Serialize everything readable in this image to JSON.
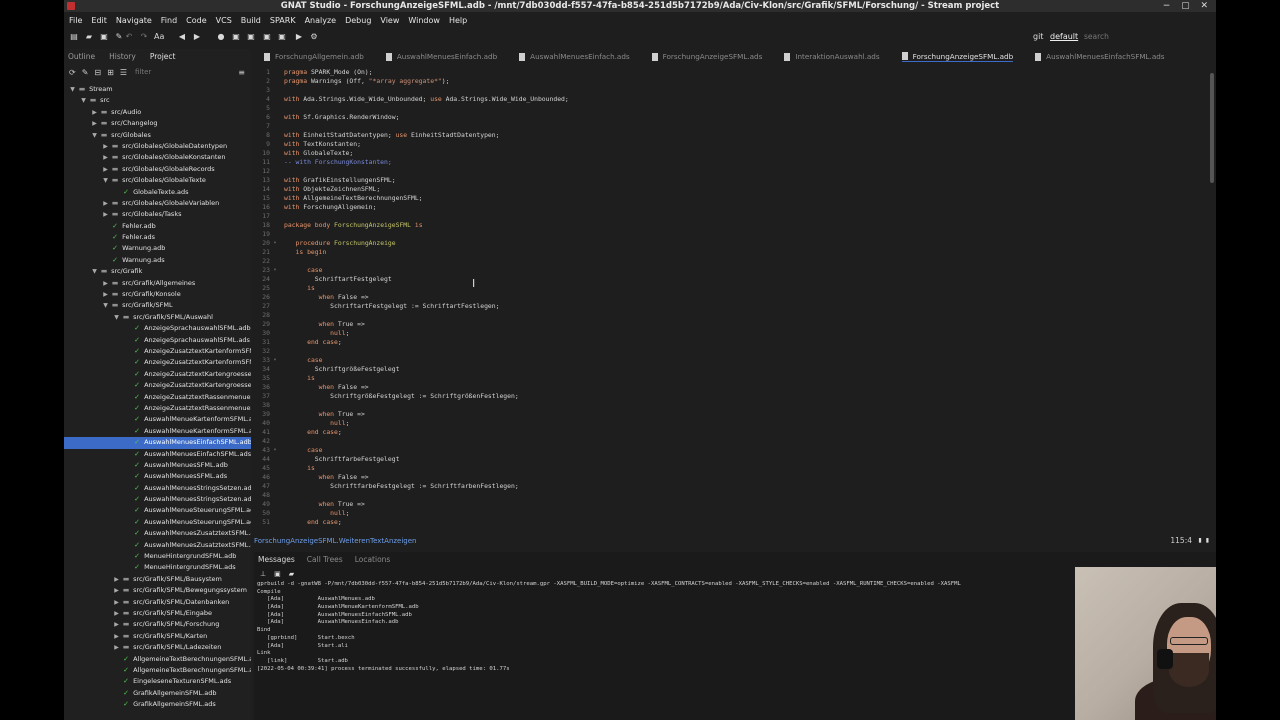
{
  "window": {
    "title": "GNAT Studio - ForschungAnzeigeSFML.adb - /mnt/7db030dd-f557-47fa-b854-251d5b7172b9/Ada/Civ-Klon/src/Grafik/SFML/Forschung/ - Stream project",
    "controls": "− ▢ ✕"
  },
  "menubar": [
    "File",
    "Edit",
    "Navigate",
    "Find",
    "Code",
    "VCS",
    "Build",
    "SPARK",
    "Analyze",
    "Debug",
    "View",
    "Window",
    "Help"
  ],
  "toolbar": {
    "git_label": "git",
    "scenario_value": "default",
    "search_placeholder": "search"
  },
  "left_panel": {
    "tabs": [
      "Outline",
      "History",
      "Project"
    ],
    "filter_placeholder": "filter",
    "tree": [
      {
        "label": "Stream",
        "depth": 0,
        "arrow": "▼",
        "icon": "folder"
      },
      {
        "label": "src",
        "depth": 1,
        "arrow": "▼",
        "icon": "folder"
      },
      {
        "label": "src/Audio",
        "depth": 2,
        "arrow": "▶",
        "icon": "folder"
      },
      {
        "label": "src/Changelog",
        "depth": 2,
        "arrow": "▶",
        "icon": "folder"
      },
      {
        "label": "src/Globales",
        "depth": 2,
        "arrow": "▼",
        "icon": "folder"
      },
      {
        "label": "src/Globales/GlobaleDatentypen",
        "depth": 3,
        "arrow": "▶",
        "icon": "folder"
      },
      {
        "label": "src/Globales/GlobaleKonstanten",
        "depth": 3,
        "arrow": "▶",
        "icon": "folder"
      },
      {
        "label": "src/Globales/GlobaleRecords",
        "depth": 3,
        "arrow": "▶",
        "icon": "folder"
      },
      {
        "label": "src/Globales/GlobaleTexte",
        "depth": 3,
        "arrow": "▼",
        "icon": "folder"
      },
      {
        "label": "GlobaleTexte.ads",
        "depth": 4,
        "arrow": "",
        "icon": "check"
      },
      {
        "label": "src/Globales/GlobaleVariablen",
        "depth": 3,
        "arrow": "▶",
        "icon": "folder"
      },
      {
        "label": "src/Globales/Tasks",
        "depth": 3,
        "arrow": "▶",
        "icon": "folder"
      },
      {
        "label": "Fehler.adb",
        "depth": 3,
        "arrow": "",
        "icon": "check"
      },
      {
        "label": "Fehler.ads",
        "depth": 3,
        "arrow": "",
        "icon": "check"
      },
      {
        "label": "Warnung.adb",
        "depth": 3,
        "arrow": "",
        "icon": "check"
      },
      {
        "label": "Warnung.ads",
        "depth": 3,
        "arrow": "",
        "icon": "check"
      },
      {
        "label": "src/Grafik",
        "depth": 2,
        "arrow": "▼",
        "icon": "folder"
      },
      {
        "label": "src/Grafik/Allgemeines",
        "depth": 3,
        "arrow": "▶",
        "icon": "folder"
      },
      {
        "label": "src/Grafik/Konsole",
        "depth": 3,
        "arrow": "▶",
        "icon": "folder"
      },
      {
        "label": "src/Grafik/SFML",
        "depth": 3,
        "arrow": "▼",
        "icon": "folder"
      },
      {
        "label": "src/Grafik/SFML/Auswahl",
        "depth": 4,
        "arrow": "▼",
        "icon": "folder"
      },
      {
        "label": "AnzeigeSprachauswahlSFML.adb",
        "depth": 5,
        "arrow": "",
        "icon": "check"
      },
      {
        "label": "AnzeigeSprachauswahlSFML.ads",
        "depth": 5,
        "arrow": "",
        "icon": "check"
      },
      {
        "label": "AnzeigeZusatztextKartenformSFM",
        "depth": 5,
        "arrow": "",
        "icon": "check"
      },
      {
        "label": "AnzeigeZusatztextKartenformSFM",
        "depth": 5,
        "arrow": "",
        "icon": "check"
      },
      {
        "label": "AnzeigeZusatztextKartengroesse",
        "depth": 5,
        "arrow": "",
        "icon": "check"
      },
      {
        "label": "AnzeigeZusatztextKartengroesse",
        "depth": 5,
        "arrow": "",
        "icon": "check"
      },
      {
        "label": "AnzeigeZusatztextRassenmenueSF",
        "depth": 5,
        "arrow": "",
        "icon": "check"
      },
      {
        "label": "AnzeigeZusatztextRassenmenueSF",
        "depth": 5,
        "arrow": "",
        "icon": "check"
      },
      {
        "label": "AuswahlMenueKartenformSFML.adb",
        "depth": 5,
        "arrow": "",
        "icon": "check"
      },
      {
        "label": "AuswahlMenueKartenformSFML.ads",
        "depth": 5,
        "arrow": "",
        "icon": "check"
      },
      {
        "label": "AuswahlMenuesEinfachSFML.adb",
        "depth": 5,
        "arrow": "",
        "icon": "check",
        "selected": true
      },
      {
        "label": "AuswahlMenuesEinfachSFML.ads",
        "depth": 5,
        "arrow": "",
        "icon": "check"
      },
      {
        "label": "AuswahlMenuesSFML.adb",
        "depth": 5,
        "arrow": "",
        "icon": "check"
      },
      {
        "label": "AuswahlMenuesSFML.ads",
        "depth": 5,
        "arrow": "",
        "icon": "check"
      },
      {
        "label": "AuswahlMenuesStringsSetzen.adb",
        "depth": 5,
        "arrow": "",
        "icon": "check"
      },
      {
        "label": "AuswahlMenuesStringsSetzen.ads",
        "depth": 5,
        "arrow": "",
        "icon": "check"
      },
      {
        "label": "AuswahlMenueSteuerungSFML.adb",
        "depth": 5,
        "arrow": "",
        "icon": "check"
      },
      {
        "label": "AuswahlMenueSteuerungSFML.ads",
        "depth": 5,
        "arrow": "",
        "icon": "check"
      },
      {
        "label": "AuswahlMenuesZusatztextSFML.ad",
        "depth": 5,
        "arrow": "",
        "icon": "check"
      },
      {
        "label": "AuswahlMenuesZusatztextSFML.ad",
        "depth": 5,
        "arrow": "",
        "icon": "check"
      },
      {
        "label": "MenueHintergrundSFML.adb",
        "depth": 5,
        "arrow": "",
        "icon": "check"
      },
      {
        "label": "MenueHintergrundSFML.ads",
        "depth": 5,
        "arrow": "",
        "icon": "check"
      },
      {
        "label": "src/Grafik/SFML/Bausystem",
        "depth": 4,
        "arrow": "▶",
        "icon": "folder"
      },
      {
        "label": "src/Grafik/SFML/Bewegungssystem",
        "depth": 4,
        "arrow": "▶",
        "icon": "folder"
      },
      {
        "label": "src/Grafik/SFML/Datenbanken",
        "depth": 4,
        "arrow": "▶",
        "icon": "folder"
      },
      {
        "label": "src/Grafik/SFML/Eingabe",
        "depth": 4,
        "arrow": "▶",
        "icon": "folder"
      },
      {
        "label": "src/Grafik/SFML/Forschung",
        "depth": 4,
        "arrow": "▶",
        "icon": "folder"
      },
      {
        "label": "src/Grafik/SFML/Karten",
        "depth": 4,
        "arrow": "▶",
        "icon": "folder"
      },
      {
        "label": "src/Grafik/SFML/Ladezeiten",
        "depth": 4,
        "arrow": "▶",
        "icon": "folder"
      },
      {
        "label": "AllgemeineTextBerechnungenSFML.ad",
        "depth": 4,
        "arrow": "",
        "icon": "check"
      },
      {
        "label": "AllgemeineTextBerechnungenSFML.ad",
        "depth": 4,
        "arrow": "",
        "icon": "check"
      },
      {
        "label": "EingeleseneTexturenSFML.ads",
        "depth": 4,
        "arrow": "",
        "icon": "check"
      },
      {
        "label": "GrafikAllgemeinSFML.adb",
        "depth": 4,
        "arrow": "",
        "icon": "check"
      },
      {
        "label": "GrafikAllgemeinSFML.ads",
        "depth": 4,
        "arrow": "",
        "icon": "check"
      }
    ]
  },
  "editor": {
    "tabs": [
      {
        "label": "ForschungAllgemein.adb",
        "active": false
      },
      {
        "label": "AuswahlMenuesEinfach.adb",
        "active": false
      },
      {
        "label": "AuswahlMenuesEinfach.ads",
        "active": false
      },
      {
        "label": "ForschungAnzeigeSFML.ads",
        "active": false
      },
      {
        "label": "InteraktionAuswahl.ads",
        "active": false
      },
      {
        "label": "ForschungAnzeigeSFML.adb",
        "active": true
      },
      {
        "label": "AuswahlMenuesEinfachSFML.ads",
        "active": false
      }
    ],
    "lines": [
      {
        "n": "1",
        "fold": "",
        "segs": [
          [
            "kw",
            "pragma"
          ],
          [
            "t",
            " SPARK_Mode (On);"
          ]
        ]
      },
      {
        "n": "2",
        "fold": "",
        "segs": [
          [
            "kw",
            "pragma"
          ],
          [
            "t",
            " Warnings (Off, "
          ],
          [
            "str",
            "\"*array aggregate*\""
          ],
          [
            "t",
            ");"
          ]
        ]
      },
      {
        "n": "3",
        "fold": "",
        "segs": []
      },
      {
        "n": "4",
        "fold": "",
        "segs": [
          [
            "kw",
            "with"
          ],
          [
            "t",
            " Ada.Strings.Wide_Wide_Unbounded; "
          ],
          [
            "kw",
            "use"
          ],
          [
            "t",
            " Ada.Strings.Wide_Wide_Unbounded;"
          ]
        ]
      },
      {
        "n": "5",
        "fold": "",
        "segs": []
      },
      {
        "n": "6",
        "fold": "",
        "segs": [
          [
            "kw",
            "with"
          ],
          [
            "t",
            " Sf.Graphics.RenderWindow;"
          ]
        ]
      },
      {
        "n": "7",
        "fold": "",
        "segs": []
      },
      {
        "n": "8",
        "fold": "",
        "segs": [
          [
            "kw",
            "with"
          ],
          [
            "t",
            " EinheitStadtDatentypen; "
          ],
          [
            "kw",
            "use"
          ],
          [
            "t",
            " EinheitStadtDatentypen;"
          ]
        ]
      },
      {
        "n": "9",
        "fold": "",
        "segs": [
          [
            "kw",
            "with"
          ],
          [
            "t",
            " TextKonstanten;"
          ]
        ]
      },
      {
        "n": "10",
        "fold": "",
        "segs": [
          [
            "kw",
            "with"
          ],
          [
            "t",
            " GlobaleTexte;"
          ]
        ]
      },
      {
        "n": "11",
        "fold": "",
        "segs": [
          [
            "cm",
            "-- with ForschungKonstanten;"
          ]
        ]
      },
      {
        "n": "12",
        "fold": "",
        "segs": []
      },
      {
        "n": "13",
        "fold": "",
        "segs": [
          [
            "kw",
            "with"
          ],
          [
            "t",
            " GrafikEinstellungenSFML;"
          ]
        ]
      },
      {
        "n": "14",
        "fold": "",
        "segs": [
          [
            "kw",
            "with"
          ],
          [
            "t",
            " ObjekteZeichnenSFML;"
          ]
        ]
      },
      {
        "n": "15",
        "fold": "",
        "segs": [
          [
            "kw",
            "with"
          ],
          [
            "t",
            " AllgemeineTextBerechnungenSFML;"
          ]
        ]
      },
      {
        "n": "16",
        "fold": "",
        "segs": [
          [
            "kw",
            "with"
          ],
          [
            "t",
            " ForschungAllgemein;"
          ]
        ]
      },
      {
        "n": "17",
        "fold": "",
        "segs": []
      },
      {
        "n": "18",
        "fold": "",
        "segs": [
          [
            "kw",
            "package body"
          ],
          [
            "t",
            " "
          ],
          [
            "ent",
            "ForschungAnzeigeSFML"
          ],
          [
            "t",
            " "
          ],
          [
            "kw",
            "is"
          ]
        ]
      },
      {
        "n": "19",
        "fold": "",
        "segs": []
      },
      {
        "n": "20",
        "fold": "▾",
        "segs": [
          [
            "t",
            "   "
          ],
          [
            "kw",
            "procedure"
          ],
          [
            "t",
            " "
          ],
          [
            "ent",
            "ForschungAnzeige"
          ]
        ]
      },
      {
        "n": "21",
        "fold": "",
        "segs": [
          [
            "t",
            "   "
          ],
          [
            "kw",
            "is begin"
          ]
        ]
      },
      {
        "n": "22",
        "fold": "",
        "segs": []
      },
      {
        "n": "23",
        "fold": "▾",
        "segs": [
          [
            "t",
            "      "
          ],
          [
            "kw",
            "case"
          ]
        ]
      },
      {
        "n": "24",
        "fold": "",
        "segs": [
          [
            "t",
            "        SchriftartFestgelegt"
          ]
        ]
      },
      {
        "n": "25",
        "fold": "",
        "segs": [
          [
            "t",
            "      "
          ],
          [
            "kw",
            "is"
          ]
        ]
      },
      {
        "n": "26",
        "fold": "",
        "segs": [
          [
            "t",
            "         "
          ],
          [
            "kw",
            "when"
          ],
          [
            "t",
            " False =>"
          ]
        ]
      },
      {
        "n": "27",
        "fold": "",
        "segs": [
          [
            "t",
            "            SchriftartFestgelegt := SchriftartFestlegen;"
          ]
        ]
      },
      {
        "n": "28",
        "fold": "",
        "segs": []
      },
      {
        "n": "29",
        "fold": "",
        "segs": [
          [
            "t",
            "         "
          ],
          [
            "kw",
            "when"
          ],
          [
            "t",
            " True =>"
          ]
        ]
      },
      {
        "n": "30",
        "fold": "",
        "segs": [
          [
            "t",
            "            "
          ],
          [
            "kw",
            "null"
          ],
          [
            "t",
            ";"
          ]
        ]
      },
      {
        "n": "31",
        "fold": "",
        "segs": [
          [
            "t",
            "      "
          ],
          [
            "kw",
            "end case"
          ],
          [
            "t",
            ";"
          ]
        ]
      },
      {
        "n": "32",
        "fold": "",
        "segs": []
      },
      {
        "n": "33",
        "fold": "▾",
        "segs": [
          [
            "t",
            "      "
          ],
          [
            "kw",
            "case"
          ]
        ]
      },
      {
        "n": "34",
        "fold": "",
        "segs": [
          [
            "t",
            "        SchriftgrößeFestgelegt"
          ]
        ]
      },
      {
        "n": "35",
        "fold": "",
        "segs": [
          [
            "t",
            "      "
          ],
          [
            "kw",
            "is"
          ]
        ]
      },
      {
        "n": "36",
        "fold": "",
        "segs": [
          [
            "t",
            "         "
          ],
          [
            "kw",
            "when"
          ],
          [
            "t",
            " False =>"
          ]
        ]
      },
      {
        "n": "37",
        "fold": "",
        "segs": [
          [
            "t",
            "            SchriftgrößeFestgelegt := SchriftgrößenFestlegen;"
          ]
        ]
      },
      {
        "n": "38",
        "fold": "",
        "segs": []
      },
      {
        "n": "39",
        "fold": "",
        "segs": [
          [
            "t",
            "         "
          ],
          [
            "kw",
            "when"
          ],
          [
            "t",
            " True =>"
          ]
        ]
      },
      {
        "n": "40",
        "fold": "",
        "segs": [
          [
            "t",
            "            "
          ],
          [
            "kw",
            "null"
          ],
          [
            "t",
            ";"
          ]
        ]
      },
      {
        "n": "41",
        "fold": "",
        "segs": [
          [
            "t",
            "      "
          ],
          [
            "kw",
            "end case"
          ],
          [
            "t",
            ";"
          ]
        ]
      },
      {
        "n": "42",
        "fold": "",
        "segs": []
      },
      {
        "n": "43",
        "fold": "▾",
        "segs": [
          [
            "t",
            "      "
          ],
          [
            "kw",
            "case"
          ]
        ]
      },
      {
        "n": "44",
        "fold": "",
        "segs": [
          [
            "t",
            "        SchriftfarbeFestgelegt"
          ]
        ]
      },
      {
        "n": "45",
        "fold": "",
        "segs": [
          [
            "t",
            "      "
          ],
          [
            "kw",
            "is"
          ]
        ]
      },
      {
        "n": "46",
        "fold": "",
        "segs": [
          [
            "t",
            "         "
          ],
          [
            "kw",
            "when"
          ],
          [
            "t",
            " False =>"
          ]
        ]
      },
      {
        "n": "47",
        "fold": "",
        "segs": [
          [
            "t",
            "            SchriftfarbeFestgelegt := SchriftfarbenFestlegen;"
          ]
        ]
      },
      {
        "n": "48",
        "fold": "",
        "segs": []
      },
      {
        "n": "49",
        "fold": "",
        "segs": [
          [
            "t",
            "         "
          ],
          [
            "kw",
            "when"
          ],
          [
            "t",
            " True =>"
          ]
        ]
      },
      {
        "n": "50",
        "fold": "",
        "segs": [
          [
            "t",
            "            "
          ],
          [
            "kw",
            "null"
          ],
          [
            "t",
            ";"
          ]
        ]
      },
      {
        "n": "51",
        "fold": "",
        "segs": [
          [
            "t",
            "      "
          ],
          [
            "kw",
            "end case"
          ],
          [
            "t",
            ";"
          ]
        ]
      }
    ],
    "status_location": "ForschungAnzeigeSFML.WeiterenTextAnzeigen",
    "cursor_position": "115:4"
  },
  "messages": {
    "tabs": [
      "Messages",
      "Call Trees",
      "Locations"
    ],
    "lines": [
      "gprbuild -d -gnatW8 -P/mnt/7db030dd-f557-47fa-b854-251d5b7172b9/Ada/Civ-Klon/stream.gpr -XASFML_BUILD_MODE=optimize -XASFML_CONTRACTS=enabled -XASFML_STYLE_CHECKS=enabled -XASFML_RUNTIME_CHECKS=enabled -XASFML",
      "Compile",
      "   [Ada]          AuswahlMenues.adb",
      "   [Ada]          AuswahlMenueKartenformSFML.adb",
      "   [Ada]          AuswahlMenuesEinfachSFML.adb",
      "   [Ada]          AuswahlMenuesEinfach.adb",
      "Bind",
      "   [gprbind]      Start.bexch",
      "   [Ada]          Start.ali",
      "Link",
      "   [link]         Start.adb",
      "[2022-05-04 00:39:41] process terminated successfully, elapsed time: 01.77s"
    ]
  },
  "colors": {
    "selection": "#3b6bc6",
    "keyword": "#e8956c",
    "entity": "#c5c56a",
    "check": "#4ec94e",
    "status_link": "#6d9de8"
  }
}
